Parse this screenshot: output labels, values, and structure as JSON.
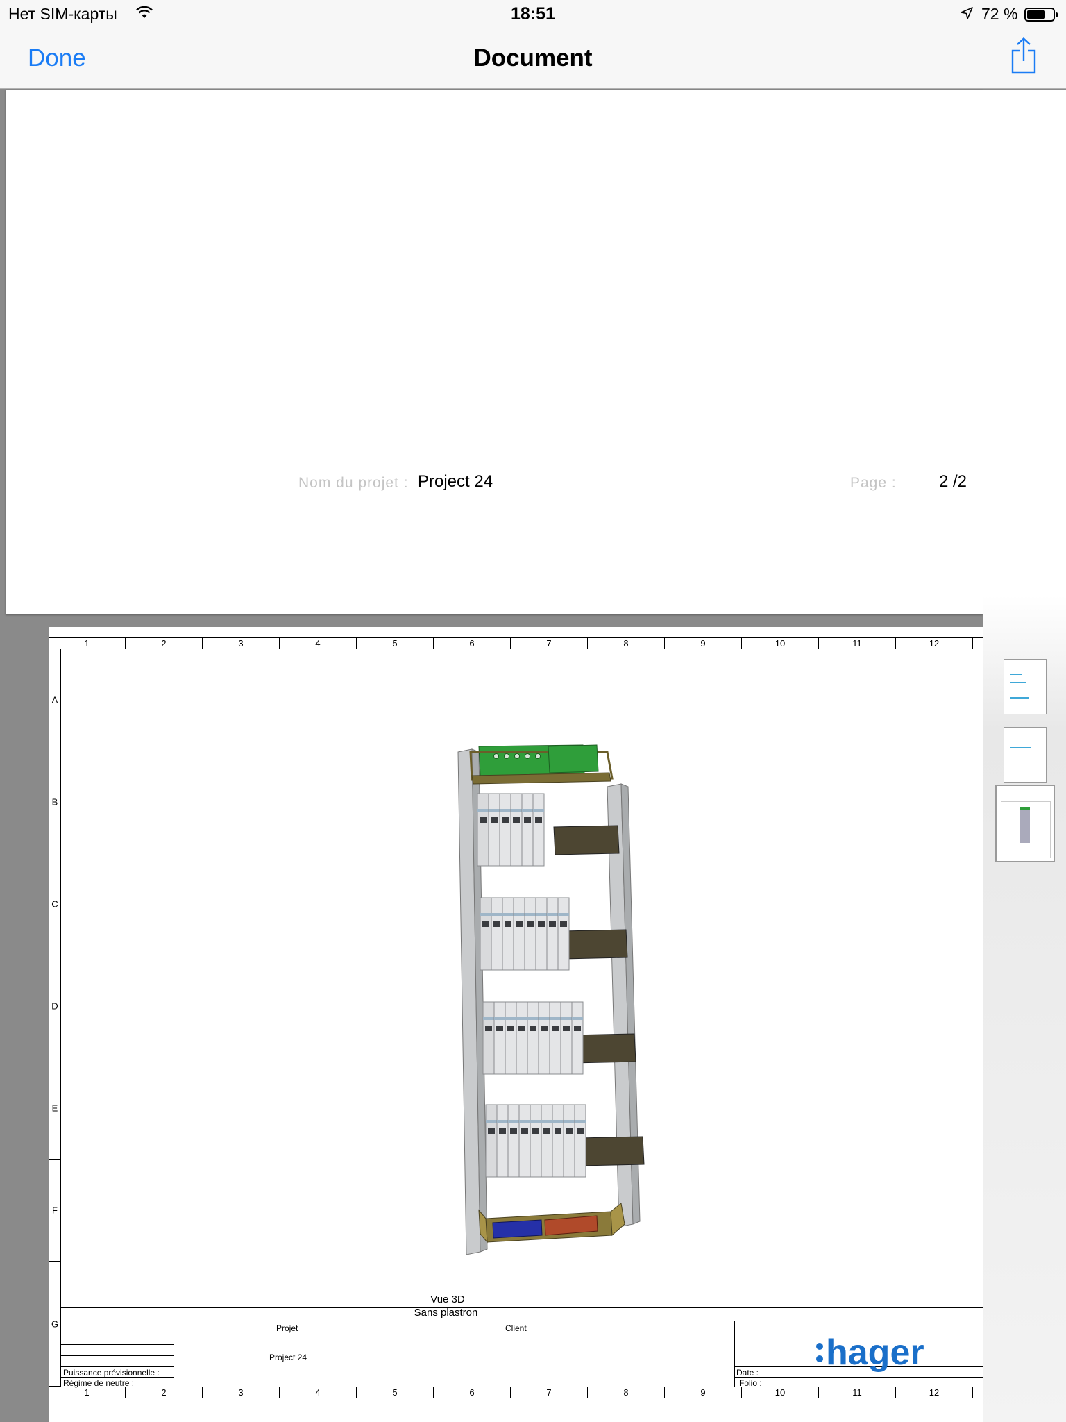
{
  "status_bar": {
    "carrier": "Нет SIM-карты",
    "time": "18:51",
    "battery": "72 %",
    "battery_level": 0.72
  },
  "nav": {
    "done_label": "Done",
    "title": "Document"
  },
  "page1": {
    "project_label": "Nom du projet :",
    "project_value": "Project 24",
    "page_label": "Page :",
    "page_value": "2 /2"
  },
  "drawing": {
    "columns": [
      "1",
      "2",
      "3",
      "4",
      "5",
      "6",
      "7",
      "8",
      "9",
      "10",
      "11",
      "12"
    ],
    "rows": [
      "A",
      "B",
      "C",
      "D",
      "E",
      "F",
      "G"
    ],
    "view_title": "Vue 3D",
    "view_subtitle": "Sans plastron",
    "titleblock": {
      "projet_label": "Projet",
      "projet_value": "Project 24",
      "client_label": "Client",
      "puissance_label": "Puissance prévisionnelle :",
      "regime_label": "Régime de neutre :",
      "date_label": "Date :",
      "folio_label": "Folio :",
      "logo_text": ":hager"
    }
  },
  "thumbnails": [
    {
      "label": "page-1",
      "selected": false
    },
    {
      "label": "page-2",
      "selected": false
    },
    {
      "label": "page-3",
      "selected": true
    }
  ],
  "colors": {
    "accent": "#1a7cf5",
    "hager_blue": "#1a6fc9"
  }
}
